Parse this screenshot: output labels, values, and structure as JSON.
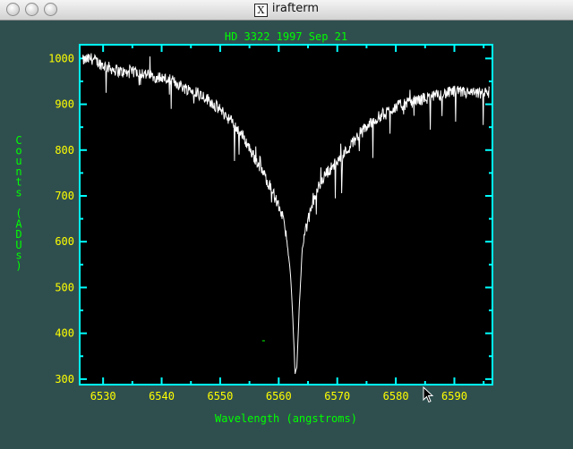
{
  "window": {
    "title": "irafterm",
    "title_icon": "X",
    "background": "#2f4f4f"
  },
  "chart_data": {
    "type": "line",
    "title": "HD 3322 1997 Sep 21",
    "xlabel": "Wavelength (angstroms)",
    "ylabel": "Counts (ADUs)",
    "xlim": [
      6526,
      6596.5
    ],
    "ylim": [
      288,
      1030
    ],
    "xticks": [
      6530,
      6540,
      6550,
      6560,
      6570,
      6580,
      6590
    ],
    "yticks": [
      300,
      400,
      500,
      600,
      700,
      800,
      900,
      1000
    ],
    "grid": false,
    "colors": {
      "frame": "#00ffff",
      "tick_labels": "#ffff00",
      "labels": "#00ff00",
      "line": "#ffffff",
      "plot_bg": "#000000"
    },
    "series": [
      {
        "x": [
          6526.5,
          6528,
          6530,
          6532,
          6534,
          6536,
          6538,
          6540,
          6542,
          6544,
          6546,
          6548,
          6550,
          6552,
          6554,
          6555.5,
          6557,
          6558.5,
          6559.5,
          6560.5,
          6561.3,
          6562,
          6562.4,
          6562.8,
          6563.1,
          6563.5,
          6564,
          6564.6,
          6565.3,
          6566.5,
          6568,
          6570,
          6572,
          6574,
          6576,
          6578,
          6580,
          6582,
          6584,
          6586,
          6588,
          6590,
          6592,
          6594,
          6596
        ],
        "y": [
          995,
          1000,
          985,
          975,
          968,
          972,
          962,
          958,
          950,
          935,
          928,
          910,
          888,
          862,
          828,
          792,
          758,
          722,
          692,
          662,
          612,
          532,
          432,
          312,
          325,
          452,
          582,
          625,
          660,
          712,
          748,
          775,
          805,
          840,
          862,
          880,
          895,
          902,
          910,
          915,
          922,
          928,
          925,
          923,
          925
        ]
      }
    ],
    "annotation": "-"
  }
}
